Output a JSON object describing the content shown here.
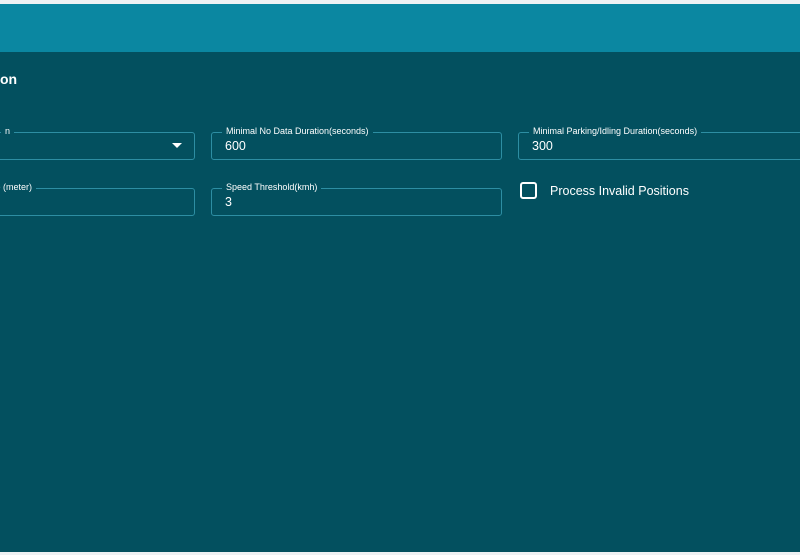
{
  "header": {
    "section_title": "on"
  },
  "fields": {
    "field_a": {
      "label": "n",
      "value": ""
    },
    "min_no_data": {
      "label": "Minimal No Data Duration(seconds)",
      "value": "600"
    },
    "min_parking": {
      "label": "Minimal Parking/Idling Duration(seconds)",
      "value": "300"
    },
    "distance": {
      "label": "ce (meter)",
      "value": ""
    },
    "speed_threshold": {
      "label": "Speed Threshold(kmh)",
      "value": "3"
    }
  },
  "checkbox": {
    "label": "Process Invalid Positions",
    "checked": false
  },
  "colors": {
    "topbar": "#0b87a1",
    "panel": "#03505f",
    "border": "#2d8ea3",
    "text": "#ffffff"
  }
}
